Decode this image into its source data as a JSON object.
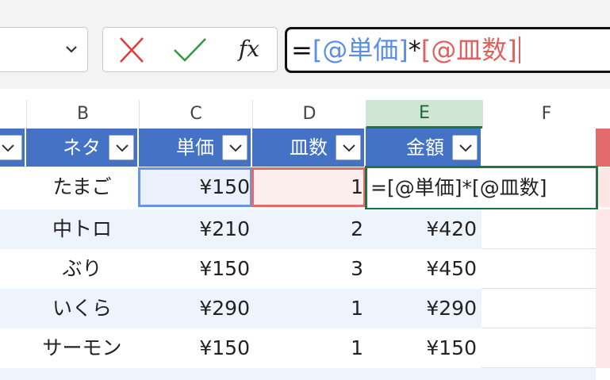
{
  "formula_bar": {
    "name_box_value": "",
    "cancel_icon": "x-icon",
    "enter_icon": "check-icon",
    "fx_label": "fx",
    "formula": {
      "eq": "=",
      "ref1": "[@単価]",
      "op": "*",
      "ref2": "[@皿数]"
    }
  },
  "columns": [
    "B",
    "C",
    "D",
    "E",
    "F"
  ],
  "table": {
    "headers": {
      "b": "ネタ",
      "c": "単価",
      "d": "皿数",
      "e": "金額"
    },
    "rows": [
      {
        "b": "たまご",
        "c": "¥150",
        "d": "1",
        "e": ""
      },
      {
        "b": "中トロ",
        "c": "¥210",
        "d": "2",
        "e": "¥420"
      },
      {
        "b": "ぶり",
        "c": "¥150",
        "d": "3",
        "e": "¥450"
      },
      {
        "b": "いくら",
        "c": "¥290",
        "d": "1",
        "e": "¥290"
      },
      {
        "b": "サーモン",
        "c": "¥150",
        "d": "1",
        "e": "¥150"
      }
    ],
    "editing_cell_formula": "=[@単価]*[@皿数]"
  },
  "colors": {
    "header_blue": "#4472c4",
    "selected_green": "#217346",
    "ref_blue": "#5b8ee6",
    "ref_red": "#e06060"
  }
}
